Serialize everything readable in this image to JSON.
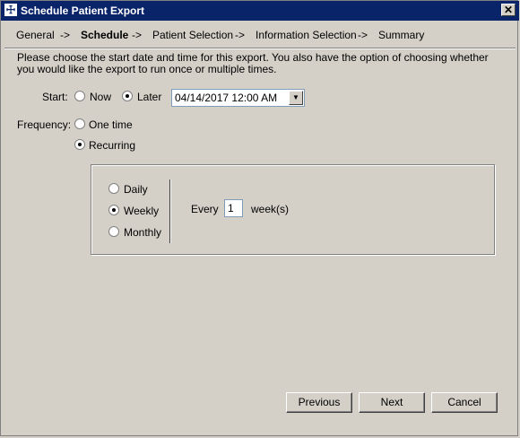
{
  "window": {
    "title": "Schedule Patient Export",
    "close_glyph": "✕",
    "icon_glyph": "☩"
  },
  "steps": [
    {
      "label": "General",
      "current": false
    },
    {
      "label": "Schedule",
      "current": true
    },
    {
      "label": "Patient Selection",
      "current": false
    },
    {
      "label": "Information Selection",
      "current": false
    },
    {
      "label": "Summary",
      "current": false
    }
  ],
  "step_arrows": [
    "->",
    "->",
    "->",
    "->"
  ],
  "instructions": "Please choose the start date and time for this export. You also have the option of choosing whether you would like the export to run once or multiple times.",
  "start": {
    "label": "Start:",
    "now_label": "Now",
    "later_label": "Later",
    "selected": "Later",
    "datetime_value": "04/14/2017 12:00 AM",
    "dropdown_glyph": "▼"
  },
  "frequency": {
    "label": "Frequency:",
    "one_time_label": "One time",
    "recurring_label": "Recurring",
    "selected": "Recurring"
  },
  "recurrence": {
    "daily_label": "Daily",
    "weekly_label": "Weekly",
    "monthly_label": "Monthly",
    "selected": "Weekly",
    "every_label": "Every",
    "every_value": "1",
    "unit_label": "week(s)"
  },
  "buttons": {
    "previous": "Previous",
    "next": "Next",
    "cancel": "Cancel"
  }
}
